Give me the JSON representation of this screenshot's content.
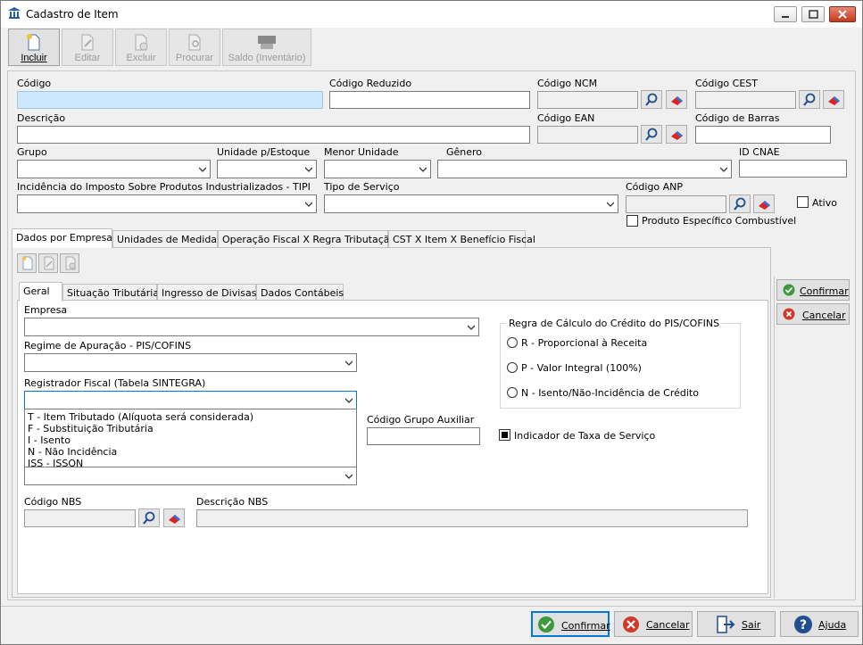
{
  "window": {
    "title": "Cadastro de Item"
  },
  "toolbar": {
    "incluir": "Incluir",
    "editar": "Editar",
    "excluir": "Excluir",
    "procurar": "Procurar",
    "saldo": "Saldo (Inventário)"
  },
  "form": {
    "codigo": {
      "label": "Código",
      "value": ""
    },
    "codigo_reduzido": {
      "label": "Código Reduzido",
      "value": ""
    },
    "codigo_ncm": {
      "label": "Código NCM",
      "value": ""
    },
    "codigo_cest": {
      "label": "Código CEST",
      "value": ""
    },
    "descricao": {
      "label": "Descrição",
      "value": ""
    },
    "codigo_ean": {
      "label": "Código EAN",
      "value": ""
    },
    "codigo_barras": {
      "label": "Código de Barras",
      "value": ""
    },
    "grupo": {
      "label": "Grupo",
      "value": ""
    },
    "unidade_estoque": {
      "label": "Unidade p/Estoque",
      "value": ""
    },
    "menor_unidade": {
      "label": "Menor Unidade",
      "value": ""
    },
    "genero": {
      "label": "Gênero",
      "value": ""
    },
    "id_cnae": {
      "label": "ID CNAE",
      "value": ""
    },
    "tipi": {
      "label": "Incidência do Imposto Sobre Produtos Industrializados - TIPI",
      "value": ""
    },
    "tipo_servico": {
      "label": "Tipo de Serviço",
      "value": ""
    },
    "codigo_anp": {
      "label": "Código ANP",
      "value": ""
    },
    "ativo": {
      "label": "Ativo",
      "checked": false
    },
    "produto_combustivel": {
      "label": "Produto Específico Combustível",
      "checked": false
    }
  },
  "outer_tabs": [
    "Dados por Empresa",
    "Unidades de Medida",
    "Operação Fiscal X Regra Tributação",
    "CST X Item X Benefício Fiscal"
  ],
  "inner_tabs": [
    "Geral",
    "Situação Tributária",
    "Ingresso de Divisas",
    "Dados Contábeis"
  ],
  "geral": {
    "empresa": {
      "label": "Empresa",
      "value": ""
    },
    "regime": {
      "label": "Regime de Apuração - PIS/COFINS",
      "value": ""
    },
    "registrador": {
      "label": "Registrador Fiscal (Tabela SINTEGRA)",
      "value": "",
      "options": [
        "T - Item Tributado (Alíquota será considerada)",
        "F - Substituição Tributária",
        "I - Isento",
        "N - Não Incidência",
        "ISS - ISSQN"
      ]
    },
    "codigo_grupo_auxiliar": {
      "label": "Código Grupo Auxiliar",
      "value": ""
    },
    "regra_credito": {
      "title": "Regra de Cálculo do Crédito do PIS/COFINS",
      "options": [
        "R - Proporcional à Receita",
        "P - Valor Integral (100%)",
        "N - Isento/Não-Incidência de Crédito"
      ]
    },
    "indicador_taxa": {
      "label": "Indicador de Taxa de Serviço",
      "checked": true
    },
    "codigo_nbs": {
      "label": "Código NBS",
      "value": ""
    },
    "descricao_nbs": {
      "label": "Descrição NBS",
      "value": ""
    }
  },
  "side_buttons": {
    "confirmar": "Confirmar",
    "cancelar": "Cancelar"
  },
  "footer": {
    "confirmar": "Confirmar",
    "cancelar": "Cancelar",
    "sair": "Sair",
    "ajuda": "Ajuda"
  }
}
